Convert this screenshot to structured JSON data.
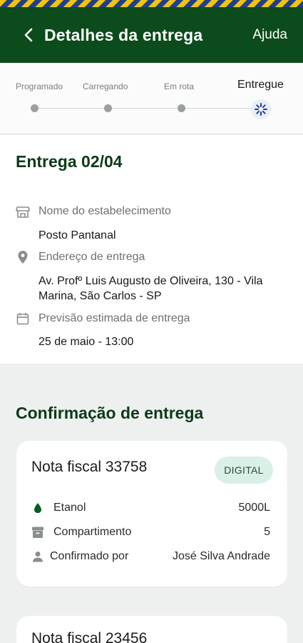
{
  "header": {
    "title": "Detalhes da entrega",
    "help": "Ajuda"
  },
  "stepper": {
    "steps": [
      "Programado",
      "Carregando",
      "Em rota",
      "Entregue"
    ],
    "current_index": 3
  },
  "delivery": {
    "title": "Entrega 02/04",
    "establishment_label": "Nome do estabelecimento",
    "establishment_value": "Posto Pantanal",
    "address_label": "Endereço de entrega",
    "address_value": "Av. Profº Luis Augusto de Oliveira, 130 - Vila Marina, São Carlos - SP",
    "eta_label": "Previsão estimada de entrega",
    "eta_value": "25 de maio - 13:00"
  },
  "confirmation": {
    "title": "Confirmação de entrega",
    "cards": [
      {
        "title": "Nota fiscal 33758",
        "badge": "DIGITAL",
        "product_label": "Etanol",
        "product_value": "5000L",
        "compartment_label": "Compartimento",
        "compartment_value": "5",
        "confirmed_label": "Confirmado por",
        "confirmed_value": "José Silva Andrade"
      },
      {
        "title": "Nota fiscal 23456"
      }
    ]
  },
  "colors": {
    "header_bg": "#0c4b1b",
    "title_green": "#0c3a17",
    "badge_bg": "#d8f0e6",
    "drop_green": "#0b5a24"
  },
  "icons": [
    "back-arrow-icon",
    "store-icon",
    "location-pin-icon",
    "calendar-icon",
    "spinner-icon",
    "drop-icon",
    "archive-icon",
    "person-icon"
  ]
}
